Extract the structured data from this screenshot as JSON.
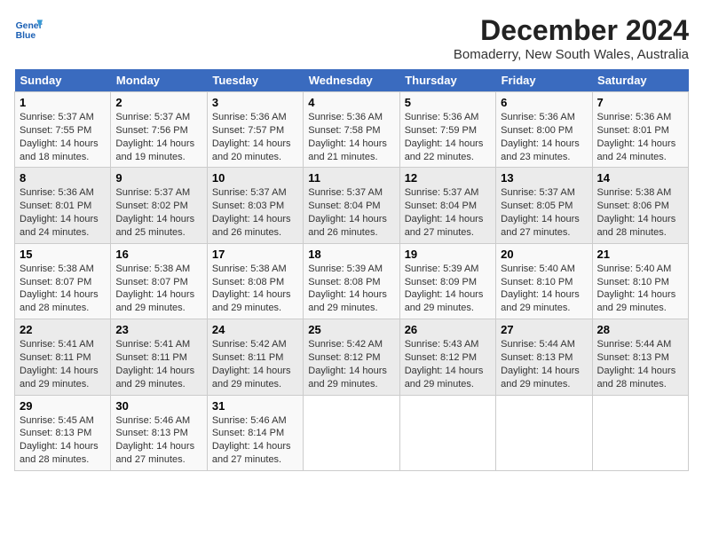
{
  "logo": {
    "line1": "General",
    "line2": "Blue"
  },
  "title": "December 2024",
  "subtitle": "Bomaderry, New South Wales, Australia",
  "header_days": [
    "Sunday",
    "Monday",
    "Tuesday",
    "Wednesday",
    "Thursday",
    "Friday",
    "Saturday"
  ],
  "weeks": [
    [
      {
        "day": "1",
        "sunrise": "5:37 AM",
        "sunset": "7:55 PM",
        "daylight": "14 hours and 18 minutes."
      },
      {
        "day": "2",
        "sunrise": "5:37 AM",
        "sunset": "7:56 PM",
        "daylight": "14 hours and 19 minutes."
      },
      {
        "day": "3",
        "sunrise": "5:36 AM",
        "sunset": "7:57 PM",
        "daylight": "14 hours and 20 minutes."
      },
      {
        "day": "4",
        "sunrise": "5:36 AM",
        "sunset": "7:58 PM",
        "daylight": "14 hours and 21 minutes."
      },
      {
        "day": "5",
        "sunrise": "5:36 AM",
        "sunset": "7:59 PM",
        "daylight": "14 hours and 22 minutes."
      },
      {
        "day": "6",
        "sunrise": "5:36 AM",
        "sunset": "8:00 PM",
        "daylight": "14 hours and 23 minutes."
      },
      {
        "day": "7",
        "sunrise": "5:36 AM",
        "sunset": "8:01 PM",
        "daylight": "14 hours and 24 minutes."
      }
    ],
    [
      {
        "day": "8",
        "sunrise": "5:36 AM",
        "sunset": "8:01 PM",
        "daylight": "14 hours and 24 minutes."
      },
      {
        "day": "9",
        "sunrise": "5:37 AM",
        "sunset": "8:02 PM",
        "daylight": "14 hours and 25 minutes."
      },
      {
        "day": "10",
        "sunrise": "5:37 AM",
        "sunset": "8:03 PM",
        "daylight": "14 hours and 26 minutes."
      },
      {
        "day": "11",
        "sunrise": "5:37 AM",
        "sunset": "8:04 PM",
        "daylight": "14 hours and 26 minutes."
      },
      {
        "day": "12",
        "sunrise": "5:37 AM",
        "sunset": "8:04 PM",
        "daylight": "14 hours and 27 minutes."
      },
      {
        "day": "13",
        "sunrise": "5:37 AM",
        "sunset": "8:05 PM",
        "daylight": "14 hours and 27 minutes."
      },
      {
        "day": "14",
        "sunrise": "5:38 AM",
        "sunset": "8:06 PM",
        "daylight": "14 hours and 28 minutes."
      }
    ],
    [
      {
        "day": "15",
        "sunrise": "5:38 AM",
        "sunset": "8:07 PM",
        "daylight": "14 hours and 28 minutes."
      },
      {
        "day": "16",
        "sunrise": "5:38 AM",
        "sunset": "8:07 PM",
        "daylight": "14 hours and 29 minutes."
      },
      {
        "day": "17",
        "sunrise": "5:38 AM",
        "sunset": "8:08 PM",
        "daylight": "14 hours and 29 minutes."
      },
      {
        "day": "18",
        "sunrise": "5:39 AM",
        "sunset": "8:08 PM",
        "daylight": "14 hours and 29 minutes."
      },
      {
        "day": "19",
        "sunrise": "5:39 AM",
        "sunset": "8:09 PM",
        "daylight": "14 hours and 29 minutes."
      },
      {
        "day": "20",
        "sunrise": "5:40 AM",
        "sunset": "8:10 PM",
        "daylight": "14 hours and 29 minutes."
      },
      {
        "day": "21",
        "sunrise": "5:40 AM",
        "sunset": "8:10 PM",
        "daylight": "14 hours and 29 minutes."
      }
    ],
    [
      {
        "day": "22",
        "sunrise": "5:41 AM",
        "sunset": "8:11 PM",
        "daylight": "14 hours and 29 minutes."
      },
      {
        "day": "23",
        "sunrise": "5:41 AM",
        "sunset": "8:11 PM",
        "daylight": "14 hours and 29 minutes."
      },
      {
        "day": "24",
        "sunrise": "5:42 AM",
        "sunset": "8:11 PM",
        "daylight": "14 hours and 29 minutes."
      },
      {
        "day": "25",
        "sunrise": "5:42 AM",
        "sunset": "8:12 PM",
        "daylight": "14 hours and 29 minutes."
      },
      {
        "day": "26",
        "sunrise": "5:43 AM",
        "sunset": "8:12 PM",
        "daylight": "14 hours and 29 minutes."
      },
      {
        "day": "27",
        "sunrise": "5:44 AM",
        "sunset": "8:13 PM",
        "daylight": "14 hours and 29 minutes."
      },
      {
        "day": "28",
        "sunrise": "5:44 AM",
        "sunset": "8:13 PM",
        "daylight": "14 hours and 28 minutes."
      }
    ],
    [
      {
        "day": "29",
        "sunrise": "5:45 AM",
        "sunset": "8:13 PM",
        "daylight": "14 hours and 28 minutes."
      },
      {
        "day": "30",
        "sunrise": "5:46 AM",
        "sunset": "8:13 PM",
        "daylight": "14 hours and 27 minutes."
      },
      {
        "day": "31",
        "sunrise": "5:46 AM",
        "sunset": "8:14 PM",
        "daylight": "14 hours and 27 minutes."
      },
      null,
      null,
      null,
      null
    ]
  ]
}
